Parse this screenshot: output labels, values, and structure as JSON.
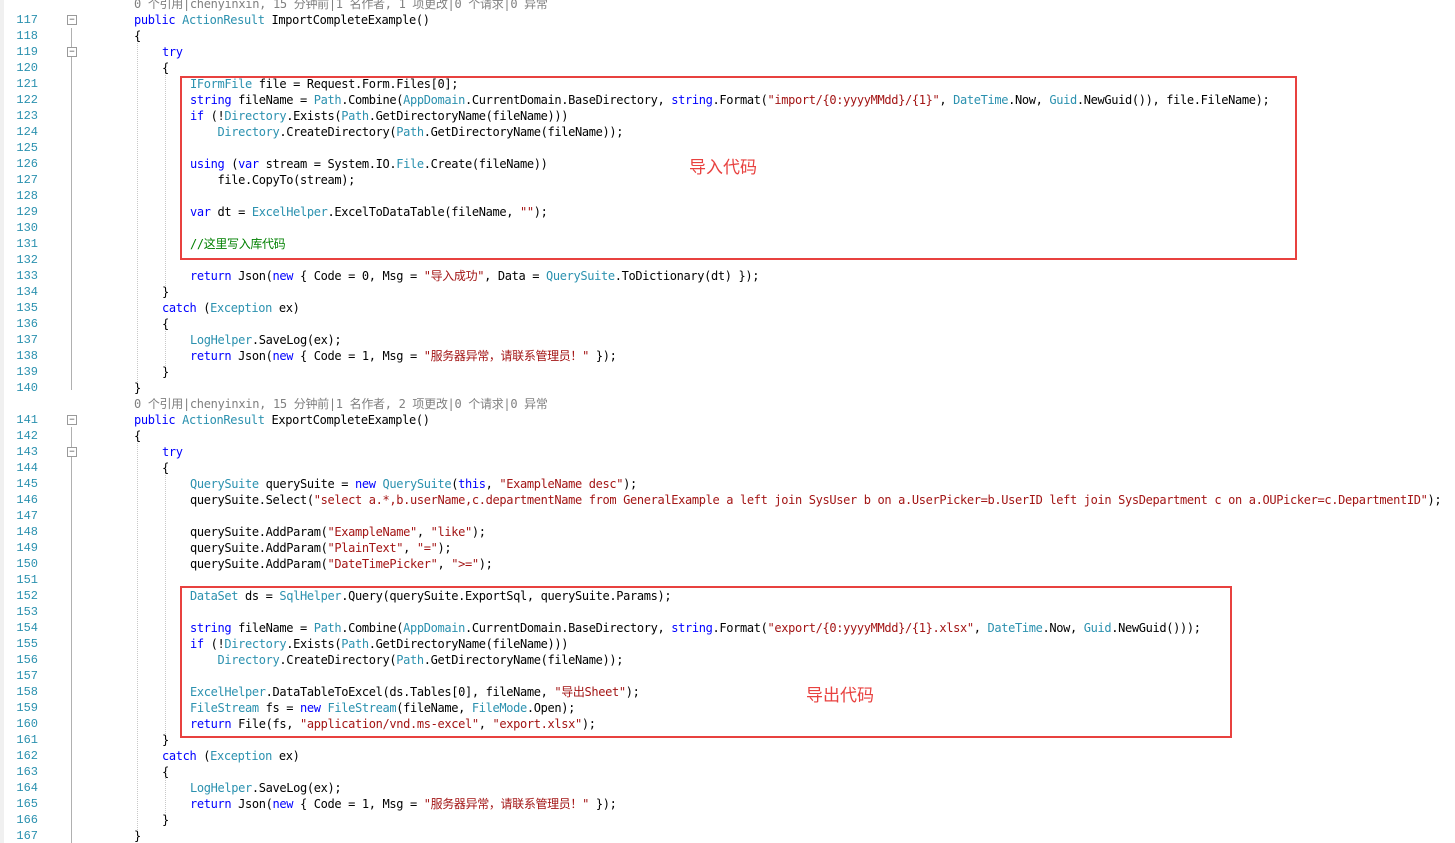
{
  "editor": {
    "lines": [
      {
        "n": "",
        "lens": true,
        "segs": [
          [
            "0 个引用|chenyinxin, 15 分钟前|1 名作者, 1 项更改|0 个请求|0 异常",
            "lens"
          ]
        ]
      },
      {
        "n": "117",
        "fold": true,
        "segs": [
          [
            "public",
            "kw"
          ],
          [
            " "
          ],
          [
            "ActionResult",
            "ty"
          ],
          [
            " ImportCompleteExample()"
          ]
        ]
      },
      {
        "n": "118",
        "segs": [
          [
            "{"
          ]
        ]
      },
      {
        "n": "119",
        "fold": true,
        "segs": [
          [
            "try",
            "kw"
          ]
        ]
      },
      {
        "n": "120",
        "segs": [
          [
            "{"
          ]
        ]
      },
      {
        "n": "121",
        "segs": [
          [
            "IFormFile",
            "ty"
          ],
          [
            " file = Request.Form.Files[0];"
          ]
        ]
      },
      {
        "n": "122",
        "segs": [
          [
            "string",
            "kw"
          ],
          [
            " fileName = "
          ],
          [
            "Path",
            "ty"
          ],
          [
            ".Combine("
          ],
          [
            "AppDomain",
            "ty"
          ],
          [
            ".CurrentDomain.BaseDirectory, "
          ],
          [
            "string",
            "kw"
          ],
          [
            ".Format("
          ],
          [
            "\"import/{0:yyyyMMdd}/{1}\"",
            "st"
          ],
          [
            ", "
          ],
          [
            "DateTime",
            "ty"
          ],
          [
            ".Now, "
          ],
          [
            "Guid",
            "ty"
          ],
          [
            ".NewGuid()), file.FileName);"
          ]
        ]
      },
      {
        "n": "123",
        "segs": [
          [
            "if",
            "kw"
          ],
          [
            " (!"
          ],
          [
            "Directory",
            "ty"
          ],
          [
            ".Exists("
          ],
          [
            "Path",
            "ty"
          ],
          [
            ".GetDirectoryName(fileName)))"
          ]
        ]
      },
      {
        "n": "124",
        "segs": [
          [
            "    "
          ],
          [
            "Directory",
            "ty"
          ],
          [
            ".CreateDirectory("
          ],
          [
            "Path",
            "ty"
          ],
          [
            ".GetDirectoryName(fileName));"
          ]
        ]
      },
      {
        "n": "125",
        "segs": [
          [
            ""
          ]
        ]
      },
      {
        "n": "126",
        "segs": [
          [
            "using",
            "kw"
          ],
          [
            " ("
          ],
          [
            "var",
            "kw"
          ],
          [
            " stream = System.IO."
          ],
          [
            "File",
            "ty"
          ],
          [
            ".Create(fileName))"
          ]
        ]
      },
      {
        "n": "127",
        "segs": [
          [
            "    file.CopyTo(stream);"
          ]
        ]
      },
      {
        "n": "128",
        "segs": [
          [
            ""
          ]
        ]
      },
      {
        "n": "129",
        "segs": [
          [
            "var",
            "kw"
          ],
          [
            " dt = "
          ],
          [
            "ExcelHelper",
            "ty"
          ],
          [
            ".ExcelToDataTable(fileName, "
          ],
          [
            "\"\"",
            "st"
          ],
          [
            ");"
          ]
        ]
      },
      {
        "n": "130",
        "segs": [
          [
            ""
          ]
        ]
      },
      {
        "n": "131",
        "segs": [
          [
            "//这里写入库代码",
            "cm"
          ]
        ]
      },
      {
        "n": "132",
        "segs": [
          [
            ""
          ]
        ]
      },
      {
        "n": "133",
        "segs": [
          [
            "return",
            "kw"
          ],
          [
            " Json("
          ],
          [
            "new",
            "kw"
          ],
          [
            " { Code = 0, Msg = "
          ],
          [
            "\"导入成功\"",
            "st"
          ],
          [
            ", Data = "
          ],
          [
            "QuerySuite",
            "ty"
          ],
          [
            ".ToDictionary(dt) });"
          ]
        ]
      },
      {
        "n": "134",
        "segs": [
          [
            "}"
          ]
        ]
      },
      {
        "n": "135",
        "segs": [
          [
            "catch",
            "kw"
          ],
          [
            " ("
          ],
          [
            "Exception",
            "ty"
          ],
          [
            " ex)"
          ]
        ]
      },
      {
        "n": "136",
        "segs": [
          [
            "{"
          ]
        ]
      },
      {
        "n": "137",
        "segs": [
          [
            "LogHelper",
            "ty"
          ],
          [
            ".SaveLog(ex);"
          ]
        ]
      },
      {
        "n": "138",
        "segs": [
          [
            "return",
            "kw"
          ],
          [
            " Json("
          ],
          [
            "new",
            "kw"
          ],
          [
            " { Code = 1, Msg = "
          ],
          [
            "\"服务器异常，请联系管理员！\"",
            "st"
          ],
          [
            " });"
          ]
        ]
      },
      {
        "n": "139",
        "segs": [
          [
            "}"
          ]
        ]
      },
      {
        "n": "140",
        "segs": [
          [
            "}"
          ]
        ]
      },
      {
        "n": "",
        "lens": true,
        "segs": [
          [
            "0 个引用|chenyinxin, 15 分钟前|1 名作者, 2 项更改|0 个请求|0 异常",
            "lens"
          ]
        ]
      },
      {
        "n": "141",
        "fold": true,
        "segs": [
          [
            "public",
            "kw"
          ],
          [
            " "
          ],
          [
            "ActionResult",
            "ty"
          ],
          [
            " ExportCompleteExample()"
          ]
        ]
      },
      {
        "n": "142",
        "segs": [
          [
            "{"
          ]
        ]
      },
      {
        "n": "143",
        "fold": true,
        "segs": [
          [
            "try",
            "kw"
          ]
        ]
      },
      {
        "n": "144",
        "segs": [
          [
            "{"
          ]
        ]
      },
      {
        "n": "145",
        "segs": [
          [
            "QuerySuite",
            "ty"
          ],
          [
            " querySuite = "
          ],
          [
            "new",
            "kw"
          ],
          [
            " "
          ],
          [
            "QuerySuite",
            "ty"
          ],
          [
            "("
          ],
          [
            "this",
            "kw"
          ],
          [
            ", "
          ],
          [
            "\"ExampleName desc\"",
            "st"
          ],
          [
            ");"
          ]
        ]
      },
      {
        "n": "146",
        "segs": [
          [
            "querySuite.Select("
          ],
          [
            "\"select a.*,b.userName,c.departmentName from GeneralExample a left join SysUser b on a.UserPicker=b.UserID left join SysDepartment c on a.OUPicker=c.DepartmentID\"",
            "st"
          ],
          [
            ");"
          ]
        ]
      },
      {
        "n": "147",
        "segs": [
          [
            ""
          ]
        ]
      },
      {
        "n": "148",
        "segs": [
          [
            "querySuite.AddParam("
          ],
          [
            "\"ExampleName\"",
            "st"
          ],
          [
            ", "
          ],
          [
            "\"like\"",
            "st"
          ],
          [
            ");"
          ]
        ]
      },
      {
        "n": "149",
        "segs": [
          [
            "querySuite.AddParam("
          ],
          [
            "\"PlainText\"",
            "st"
          ],
          [
            ", "
          ],
          [
            "\"=\"",
            "st"
          ],
          [
            ");"
          ]
        ]
      },
      {
        "n": "150",
        "segs": [
          [
            "querySuite.AddParam("
          ],
          [
            "\"DateTimePicker\"",
            "st"
          ],
          [
            ", "
          ],
          [
            "\">=\"",
            "st"
          ],
          [
            ");"
          ]
        ]
      },
      {
        "n": "151",
        "segs": [
          [
            ""
          ]
        ]
      },
      {
        "n": "152",
        "segs": [
          [
            "DataSet",
            "ty"
          ],
          [
            " ds = "
          ],
          [
            "SqlHelper",
            "ty"
          ],
          [
            ".Query(querySuite.ExportSql, querySuite.Params);"
          ]
        ]
      },
      {
        "n": "153",
        "segs": [
          [
            ""
          ]
        ]
      },
      {
        "n": "154",
        "segs": [
          [
            "string",
            "kw"
          ],
          [
            " fileName = "
          ],
          [
            "Path",
            "ty"
          ],
          [
            ".Combine("
          ],
          [
            "AppDomain",
            "ty"
          ],
          [
            ".CurrentDomain.BaseDirectory, "
          ],
          [
            "string",
            "kw"
          ],
          [
            ".Format("
          ],
          [
            "\"export/{0:yyyyMMdd}/{1}.xlsx\"",
            "st"
          ],
          [
            ", "
          ],
          [
            "DateTime",
            "ty"
          ],
          [
            ".Now, "
          ],
          [
            "Guid",
            "ty"
          ],
          [
            ".NewGuid()));"
          ]
        ]
      },
      {
        "n": "155",
        "segs": [
          [
            "if",
            "kw"
          ],
          [
            " (!"
          ],
          [
            "Directory",
            "ty"
          ],
          [
            ".Exists("
          ],
          [
            "Path",
            "ty"
          ],
          [
            ".GetDirectoryName(fileName)))"
          ]
        ]
      },
      {
        "n": "156",
        "segs": [
          [
            "    "
          ],
          [
            "Directory",
            "ty"
          ],
          [
            ".CreateDirectory("
          ],
          [
            "Path",
            "ty"
          ],
          [
            ".GetDirectoryName(fileName));"
          ]
        ]
      },
      {
        "n": "157",
        "segs": [
          [
            ""
          ]
        ]
      },
      {
        "n": "158",
        "segs": [
          [
            "ExcelHelper",
            "ty"
          ],
          [
            ".DataTableToExcel(ds.Tables[0], fileName, "
          ],
          [
            "\"导出Sheet\"",
            "st"
          ],
          [
            ");"
          ]
        ]
      },
      {
        "n": "159",
        "segs": [
          [
            "FileStream",
            "ty"
          ],
          [
            " fs = "
          ],
          [
            "new",
            "kw"
          ],
          [
            " "
          ],
          [
            "FileStream",
            "ty"
          ],
          [
            "(fileName, "
          ],
          [
            "FileMode",
            "ty"
          ],
          [
            ".Open);"
          ]
        ]
      },
      {
        "n": "160",
        "segs": [
          [
            "return",
            "kw"
          ],
          [
            " File(fs, "
          ],
          [
            "\"application/vnd.ms-excel\"",
            "st"
          ],
          [
            ", "
          ],
          [
            "\"export.xlsx\"",
            "st"
          ],
          [
            ");"
          ]
        ]
      },
      {
        "n": "161",
        "segs": [
          [
            "}"
          ]
        ]
      },
      {
        "n": "162",
        "segs": [
          [
            "catch",
            "kw"
          ],
          [
            " ("
          ],
          [
            "Exception",
            "ty"
          ],
          [
            " ex)"
          ]
        ]
      },
      {
        "n": "163",
        "segs": [
          [
            "{"
          ]
        ]
      },
      {
        "n": "164",
        "segs": [
          [
            "LogHelper",
            "ty"
          ],
          [
            ".SaveLog(ex);"
          ]
        ]
      },
      {
        "n": "165",
        "segs": [
          [
            "return",
            "kw"
          ],
          [
            " Json("
          ],
          [
            "new",
            "kw"
          ],
          [
            " { Code = 1, Msg = "
          ],
          [
            "\"服务器异常，请联系管理员！\"",
            "st"
          ],
          [
            " });"
          ]
        ]
      },
      {
        "n": "166",
        "segs": [
          [
            "}"
          ]
        ]
      },
      {
        "n": "167",
        "segs": [
          [
            "}"
          ]
        ]
      }
    ]
  },
  "annotations": {
    "import_label": "导入代码",
    "export_label": "导出代码",
    "color": "#e8413f"
  },
  "theme": {
    "keyword": "#0000ff",
    "type": "#2b91af",
    "string": "#a31515",
    "comment": "#008000",
    "line_number": "#2b91af",
    "codelens": "#808080"
  }
}
